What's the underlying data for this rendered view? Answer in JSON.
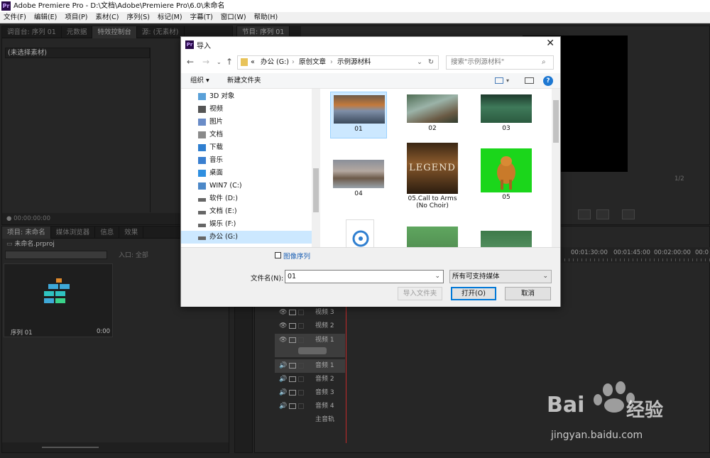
{
  "app": {
    "title": "Adobe Premiere Pro - D:\\文档\\Adobe\\Premiere Pro\\6.0\\未命名",
    "logo_text": "Pr"
  },
  "menu": [
    "文件(F)",
    "编辑(E)",
    "项目(P)",
    "素材(C)",
    "序列(S)",
    "标记(M)",
    "字幕(T)",
    "窗口(W)",
    "帮助(H)"
  ],
  "source_panel": {
    "tabs": [
      "调音台: 序列 01",
      "元数据",
      "特效控制台",
      "源: (无素材)"
    ],
    "no_clip_label": "(未选择素材)",
    "timecode": "00:00:00:00"
  },
  "program_monitor": {
    "tab": "节目: 序列 01",
    "zoom": "1/2"
  },
  "project_panel": {
    "tabs": [
      "项目: 未命名",
      "媒体浏览器",
      "信息",
      "效果"
    ],
    "project_file": "未命名.prproj",
    "inpoint_label": "入口: 全部",
    "sequence_name": "序列 01",
    "sequence_duration": "0:00"
  },
  "timeline": {
    "ruler_times": [
      "00:01:30:00",
      "00:01:45:00",
      "00:02:00:00",
      "00:0"
    ],
    "video_tracks": [
      "视频 3",
      "视频 2",
      "视频 1"
    ],
    "audio_tracks": [
      "音频 1",
      "音频 2",
      "音频 3",
      "音频 4"
    ],
    "master_track": "主音轨"
  },
  "dialog": {
    "title": "导入",
    "breadcrumb": [
      "«",
      "办公 (G:)",
      "原创文章",
      "示例源材料"
    ],
    "search_placeholder": "搜索\"示例源材料\"",
    "organize": "组织 ▾",
    "new_folder": "新建文件夹",
    "nav_items": [
      {
        "label": "3D 对象",
        "icon": "3d-objects-icon",
        "color": "#5aa0d8"
      },
      {
        "label": "视频",
        "icon": "video-icon",
        "color": "#555555"
      },
      {
        "label": "图片",
        "icon": "picture-icon",
        "color": "#6a8cc7"
      },
      {
        "label": "文档",
        "icon": "document-icon",
        "color": "#8a8a8a"
      },
      {
        "label": "下载",
        "icon": "download-icon",
        "color": "#2f7fd0"
      },
      {
        "label": "音乐",
        "icon": "music-icon",
        "color": "#3a7fd0"
      },
      {
        "label": "桌面",
        "icon": "desktop-icon",
        "color": "#2f8fe0"
      },
      {
        "label": "WIN7 (C:)",
        "icon": "drive-c-icon",
        "color": "#4c88c8"
      },
      {
        "label": "软件 (D:)",
        "icon": "drive-icon",
        "color": "#666666"
      },
      {
        "label": "文档 (E:)",
        "icon": "drive-icon",
        "color": "#666666"
      },
      {
        "label": "娱乐 (F:)",
        "icon": "drive-icon",
        "color": "#666666"
      },
      {
        "label": "办公 (G:)",
        "icon": "drive-icon",
        "color": "#666666"
      }
    ],
    "files": [
      {
        "name": "01",
        "bg": "linear-gradient(180deg,#6d5a4a 0%,#c47a3c 35%,#7f8fa8 55%,#3b4a5c 100%)"
      },
      {
        "name": "02",
        "bg": "linear-gradient(160deg,#4f6d54 0%,#9bb3a8 40%,#6a5a44 75%,#2f3c2e 100%)"
      },
      {
        "name": "03",
        "bg": "linear-gradient(180deg,#1d3a2c 0%,#3f7a5a 45%,#2b5a3f 100%)"
      },
      {
        "name": "04",
        "bg": "linear-gradient(180deg,#8a8f99 0%,#b4a8a0 40%,#6c5a4a 65%,#9aa3ac 100%)"
      },
      {
        "name": "05.Call to Arms\n(No Choir)",
        "bg": "linear-gradient(180deg,#3a2614 0%,#8a5a2c 40%,#2b1c0f 100%)",
        "overlay": "LEGEND"
      },
      {
        "name": "05",
        "bg": "#1bd61b"
      },
      {
        "name": "",
        "bg": "#ffffff"
      },
      {
        "name": "",
        "bg": "linear-gradient(180deg,#5fa65f 0%,#4f8a4f 100%)"
      },
      {
        "name": "",
        "bg": "linear-gradient(180deg,#3e7a4a 0%,#5d9a6a 100%)"
      }
    ],
    "image_sequence_label": "图像序列",
    "filename_label": "文件名(N):",
    "filename_value": "01",
    "filetype_value": "所有可支持媒体",
    "import_folder_button": "导入文件夹",
    "open_button": "打开(O)",
    "cancel_button": "取消"
  },
  "watermark": {
    "brand": "Bai",
    "brand_tail": "经验",
    "url": "jingyan.baidu.com"
  }
}
